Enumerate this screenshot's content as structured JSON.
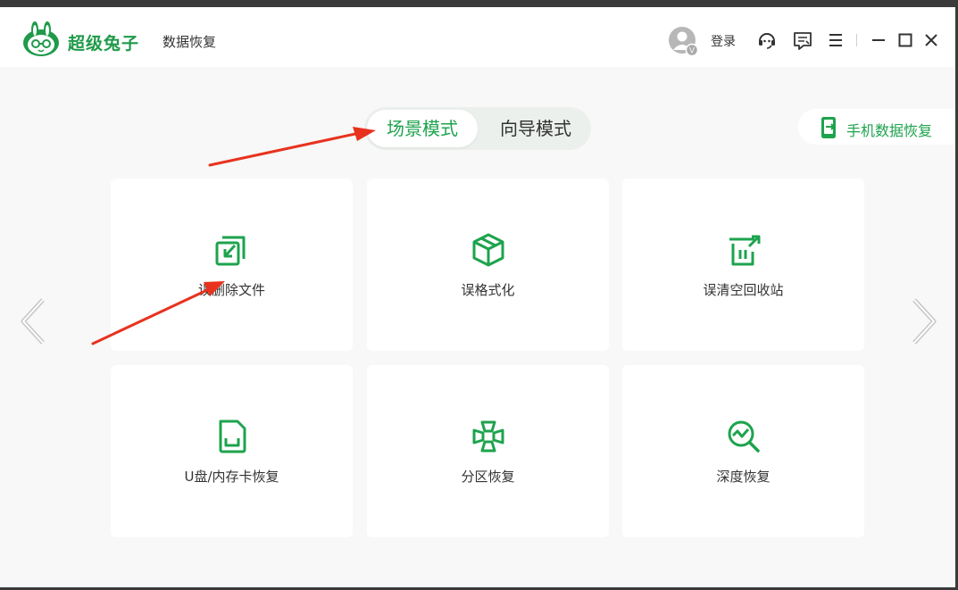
{
  "app": {
    "brand": "超级兔子",
    "product": "数据恢复",
    "login_label": "登录",
    "avatar_badge": "V",
    "accent_color": "#1ea34d"
  },
  "modes": {
    "active": "场景模式",
    "inactive": "向导模式"
  },
  "phone_button": {
    "label": "手机数据恢复"
  },
  "cards": [
    {
      "label": "误删除文件",
      "icon": "deleted-file-recover-icon"
    },
    {
      "label": "误格式化",
      "icon": "format-cube-icon"
    },
    {
      "label": "误清空回收站",
      "icon": "recycle-bin-icon"
    },
    {
      "label": "U盘/内存卡恢复",
      "icon": "sd-card-icon"
    },
    {
      "label": "分区恢复",
      "icon": "partition-icon"
    },
    {
      "label": "深度恢复",
      "icon": "deep-scan-icon"
    }
  ],
  "annotation_color": "#e8321e"
}
